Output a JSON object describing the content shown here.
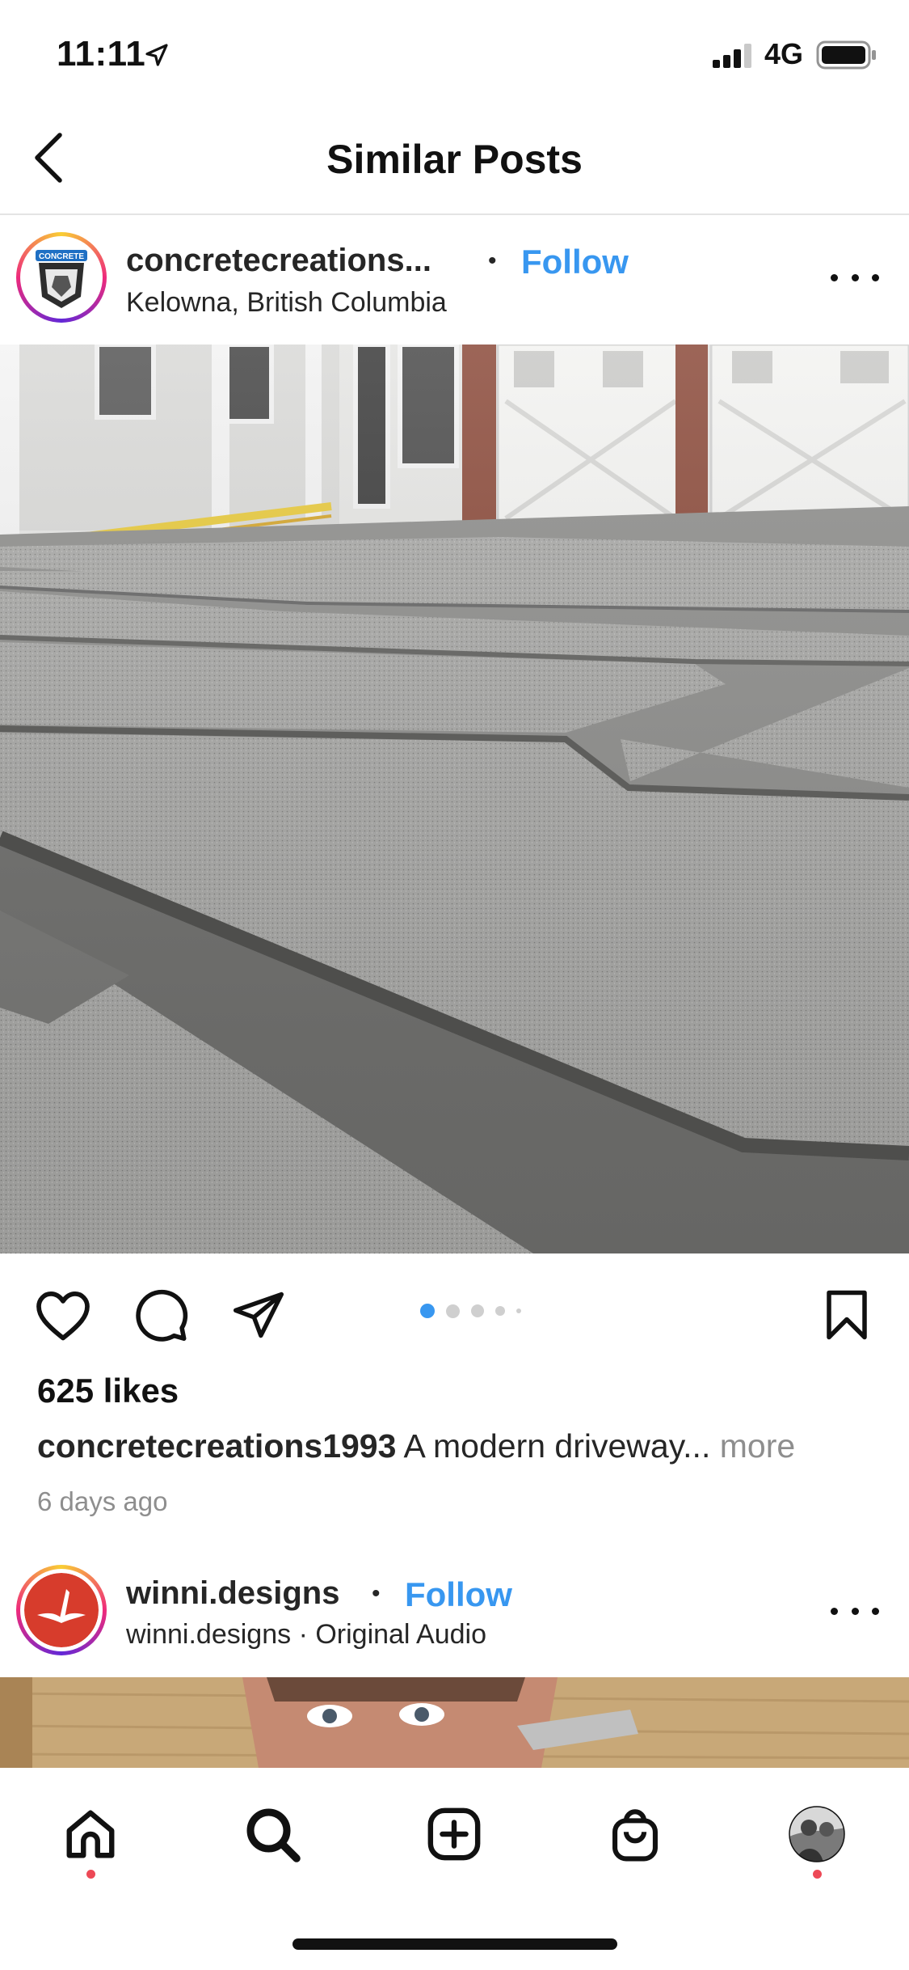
{
  "status_bar": {
    "time": "11:11",
    "network": "4G"
  },
  "header": {
    "title": "Similar Posts"
  },
  "post1": {
    "username": "concretecreations...",
    "follow_label": "Follow",
    "location": "Kelowna, British Columbia",
    "likes": "625 likes",
    "caption_user": "concretecreations1993",
    "caption_text": " A modern driveway...",
    "caption_more": " more",
    "timestamp": "6 days ago",
    "carousel": {
      "count": 5,
      "active_index": 0
    },
    "avatar_text": "CONCRETE"
  },
  "post2": {
    "username": "winni.designs",
    "follow_label": "Follow",
    "subline": "winni.designs · Original Audio"
  },
  "tabbar": {
    "items": [
      "home",
      "search",
      "create",
      "shop",
      "profile"
    ]
  },
  "colors": {
    "accent": "#3897f0",
    "notification": "#ed4956"
  }
}
